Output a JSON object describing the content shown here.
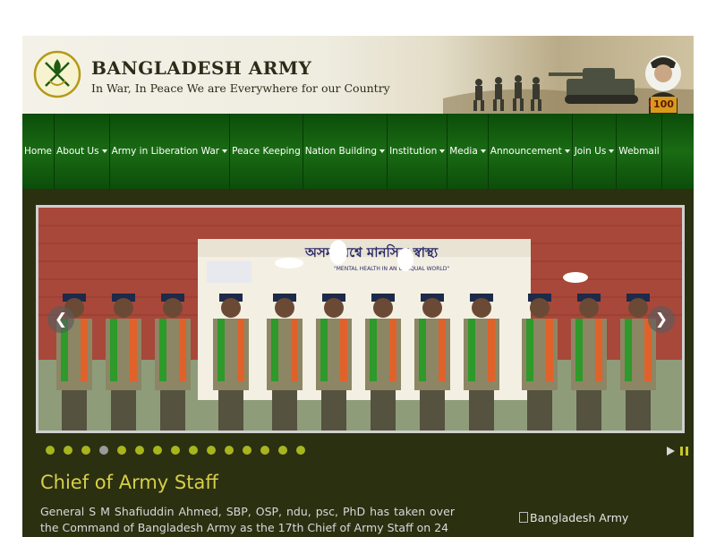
{
  "header": {
    "title": "BANGLADESH ARMY",
    "tagline": "In War, In Peace We are Everywhere for our Country",
    "badge": "100"
  },
  "nav": {
    "items": [
      {
        "label": "Home",
        "dropdown": false
      },
      {
        "label": "About Us",
        "dropdown": true
      },
      {
        "label": "Army in Liberation War",
        "dropdown": true
      },
      {
        "label": "Peace Keeping",
        "dropdown": false
      },
      {
        "label": "Nation Building",
        "dropdown": true
      },
      {
        "label": "Institution",
        "dropdown": true
      },
      {
        "label": "Media",
        "dropdown": true
      },
      {
        "label": "Announcement",
        "dropdown": true
      },
      {
        "label": "Join Us",
        "dropdown": true
      },
      {
        "label": "Webmail",
        "dropdown": false
      }
    ]
  },
  "slider": {
    "banner_text": "অসম বিশ্বে মানসিক স্বাস্থ্য",
    "banner_subtext": "\"MENTAL HEALTH IN AN UNEQUAL WORLD\"",
    "prev_icon": "chevron-left-icon",
    "next_icon": "chevron-right-icon",
    "dot_count": 15,
    "active_dot": 4,
    "play_icon": "play-icon",
    "pause_icon": "pause-icon"
  },
  "coas": {
    "heading": "Chief of Army Staff",
    "text": "General S M Shafiuddin Ahmed, SBP, OSP, ndu, psc, PhD has taken over the Command of Bangladesh Army as the 17th Chief of Army Staff on 24",
    "image_alt": "Bangladesh Army"
  },
  "colors": {
    "nav_green": "#1a6b14",
    "accent_yellow": "#d7cf48",
    "dot_green": "#a8b51e"
  }
}
